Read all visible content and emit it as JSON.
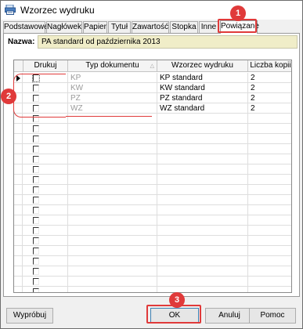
{
  "window": {
    "title": "Wzorzec wydruku"
  },
  "tabs": [
    {
      "label": "Podstawowe"
    },
    {
      "label": "Nagłówek"
    },
    {
      "label": "Papier"
    },
    {
      "label": "Tytuł"
    },
    {
      "label": "Zawartość"
    },
    {
      "label": "Stopka"
    },
    {
      "label": "Inne"
    },
    {
      "label": "Powiązane",
      "active": true
    }
  ],
  "form": {
    "name_label": "Nazwa:",
    "name_value": "PA standard od października 2013"
  },
  "grid": {
    "columns": [
      "Drukuj",
      "Typ dokumentu",
      "Wzorzec wydruku",
      "Liczba kopii"
    ],
    "sort_glyph": "△",
    "rows": [
      {
        "print": false,
        "doc_type": "KP",
        "template": "KP standard",
        "copies": "2"
      },
      {
        "print": false,
        "doc_type": "KW",
        "template": "KW standard",
        "copies": "2"
      },
      {
        "print": false,
        "doc_type": "PZ",
        "template": "PZ standard",
        "copies": "2"
      },
      {
        "print": false,
        "doc_type": "WZ",
        "template": "WZ standard",
        "copies": "2"
      }
    ],
    "empty_rows": 18
  },
  "buttons": {
    "test": "Wypróbuj",
    "ok": "OK",
    "cancel": "Anuluj",
    "help": "Pomoc"
  },
  "annotations": {
    "badge_1": "1",
    "badge_2": "2",
    "badge_3": "3",
    "color": "#e03a3a"
  }
}
